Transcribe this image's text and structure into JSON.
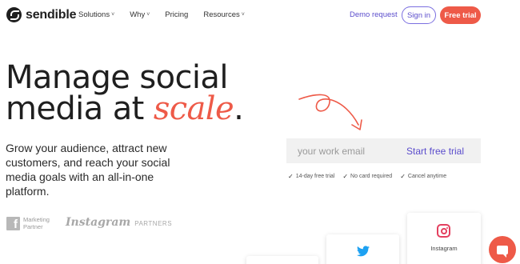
{
  "brand": {
    "name": "sendible"
  },
  "nav": {
    "items": [
      {
        "label": "Solutions",
        "has_dropdown": true
      },
      {
        "label": "Why",
        "has_dropdown": true
      },
      {
        "label": "Pricing",
        "has_dropdown": false
      },
      {
        "label": "Resources",
        "has_dropdown": true
      }
    ],
    "chevron": "˅",
    "demo_label": "Demo request",
    "signin_label": "Sign in",
    "trial_label": "Free trial"
  },
  "hero": {
    "headline_line1": "Manage social",
    "headline_line2_start": "media at ",
    "headline_accent": "scale",
    "headline_end": ".",
    "subtext": "Grow your audience, attract new customers, and reach your social media goals with an all-in-one platform."
  },
  "partners": {
    "facebook_glyph": "f",
    "facebook_line1": "Marketing",
    "facebook_line2": "Partner",
    "instagram_word": "Instagram",
    "instagram_sub": "PARTNERS"
  },
  "signup": {
    "email_placeholder": "your work email",
    "button_label": "Start free trial",
    "checks": [
      "14-day free trial",
      "No card required",
      "Cancel anytime"
    ],
    "check_glyph": "✓"
  },
  "cards": {
    "instagram_label": "Instagram"
  },
  "colors": {
    "accent": "#ee5a48",
    "brand_purple": "#5b4dcc",
    "twitter": "#1da1f2",
    "instagram": "#e4405f"
  },
  "icons": [
    "logo-icon",
    "chevron-down-icon",
    "arrow-doodle-icon",
    "check-icon",
    "facebook-icon",
    "twitter-icon",
    "instagram-icon",
    "chat-icon"
  ]
}
